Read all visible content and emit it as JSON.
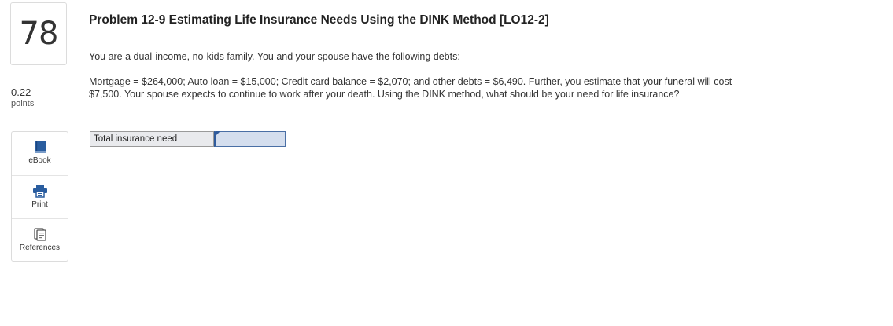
{
  "question": {
    "number": "78",
    "points_value": "0.22",
    "points_label": "points"
  },
  "tools": [
    {
      "label": "eBook",
      "icon": "book-icon"
    },
    {
      "label": "Print",
      "icon": "printer-icon"
    },
    {
      "label": "References",
      "icon": "references-icon"
    }
  ],
  "problem": {
    "title": "Problem 12-9 Estimating Life Insurance Needs Using the DINK Method [LO12-2]",
    "intro": "You are a dual-income, no-kids family. You and your spouse have the following debts:",
    "body": "Mortgage = $264,000; Auto loan = $15,000; Credit card balance = $2,070; and other debts = $6,490. Further, you estimate that your funeral will cost $7,500. Your spouse expects to continue to work after your death. Using the DINK method, what should be your need for life insurance?"
  },
  "answer": {
    "label": "Total insurance need",
    "value": ""
  },
  "colors": {
    "input_bg": "#d4deee",
    "input_border": "#2f5b9c",
    "label_bg": "#e9eaed",
    "icon_blue": "#2a5d9f"
  }
}
